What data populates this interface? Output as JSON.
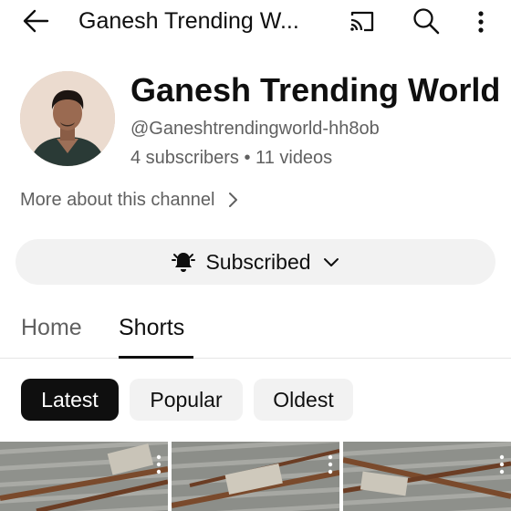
{
  "header": {
    "title": "Ganesh Trending W...",
    "icons": [
      "back-arrow-icon",
      "cast-icon",
      "search-icon",
      "more-vertical-icon"
    ]
  },
  "channel": {
    "name": "Ganesh Trending World",
    "handle": "@Ganeshtrendingworld-hh8ob",
    "stats": "4 subscribers • 11 videos",
    "more_about": "More about this channel"
  },
  "subscribe": {
    "label": "Subscribed",
    "icons": [
      "bell-icon",
      "chevron-down-icon"
    ]
  },
  "tabs": [
    {
      "label": "Home",
      "active": false
    },
    {
      "label": "Shorts",
      "active": true
    }
  ],
  "filters": [
    {
      "label": "Latest",
      "selected": true
    },
    {
      "label": "Popular",
      "selected": false
    },
    {
      "label": "Oldest",
      "selected": false
    }
  ],
  "colors": {
    "text_primary": "#0f0f0f",
    "text_secondary": "#606060",
    "chip_background": "#f2f2f2",
    "active_chip": "#0f0f0f",
    "divider": "#e5e5e5"
  }
}
